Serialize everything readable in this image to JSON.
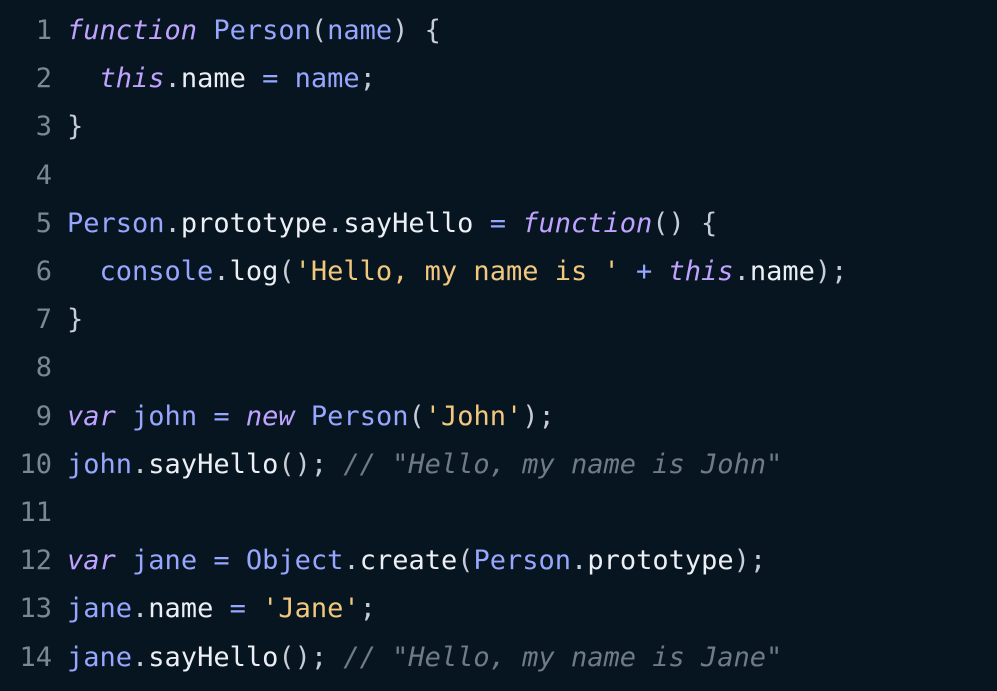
{
  "editor": {
    "background": "#071520",
    "colors": {
      "keyword": "#c0a3ff",
      "identifier": "#97a6ff",
      "property": "#eceff4",
      "string": "#f1c87e",
      "comment": "#6f7b88",
      "line_number": "#7a8794"
    },
    "lines": [
      {
        "number": "1",
        "tokens": [
          {
            "type": "kw",
            "text": "function"
          },
          {
            "type": "punc",
            "text": " "
          },
          {
            "type": "fn",
            "text": "Person"
          },
          {
            "type": "punc",
            "text": "("
          },
          {
            "type": "id",
            "text": "name"
          },
          {
            "type": "punc",
            "text": ") {"
          }
        ]
      },
      {
        "number": "2",
        "tokens": [
          {
            "type": "punc",
            "text": "  "
          },
          {
            "type": "kw",
            "text": "this"
          },
          {
            "type": "punc",
            "text": "."
          },
          {
            "type": "prop",
            "text": "name"
          },
          {
            "type": "punc",
            "text": " "
          },
          {
            "type": "op",
            "text": "="
          },
          {
            "type": "punc",
            "text": " "
          },
          {
            "type": "id",
            "text": "name"
          },
          {
            "type": "punc",
            "text": ";"
          }
        ]
      },
      {
        "number": "3",
        "tokens": [
          {
            "type": "punc",
            "text": "}"
          }
        ]
      },
      {
        "number": "4",
        "tokens": []
      },
      {
        "number": "5",
        "tokens": [
          {
            "type": "fn",
            "text": "Person"
          },
          {
            "type": "punc",
            "text": "."
          },
          {
            "type": "prop",
            "text": "prototype"
          },
          {
            "type": "punc",
            "text": "."
          },
          {
            "type": "prop",
            "text": "sayHello"
          },
          {
            "type": "punc",
            "text": " "
          },
          {
            "type": "op",
            "text": "="
          },
          {
            "type": "punc",
            "text": " "
          },
          {
            "type": "kw",
            "text": "function"
          },
          {
            "type": "punc",
            "text": "() {"
          }
        ]
      },
      {
        "number": "6",
        "tokens": [
          {
            "type": "punc",
            "text": "  "
          },
          {
            "type": "id",
            "text": "console"
          },
          {
            "type": "punc",
            "text": "."
          },
          {
            "type": "prop",
            "text": "log"
          },
          {
            "type": "punc",
            "text": "("
          },
          {
            "type": "str",
            "text": "'Hello, my name is '"
          },
          {
            "type": "punc",
            "text": " "
          },
          {
            "type": "op",
            "text": "+"
          },
          {
            "type": "punc",
            "text": " "
          },
          {
            "type": "kw",
            "text": "this"
          },
          {
            "type": "punc",
            "text": "."
          },
          {
            "type": "prop",
            "text": "name"
          },
          {
            "type": "punc",
            "text": ");"
          }
        ]
      },
      {
        "number": "7",
        "tokens": [
          {
            "type": "punc",
            "text": "}"
          }
        ]
      },
      {
        "number": "8",
        "tokens": []
      },
      {
        "number": "9",
        "tokens": [
          {
            "type": "kw",
            "text": "var"
          },
          {
            "type": "punc",
            "text": " "
          },
          {
            "type": "id",
            "text": "john"
          },
          {
            "type": "punc",
            "text": " "
          },
          {
            "type": "op",
            "text": "="
          },
          {
            "type": "punc",
            "text": " "
          },
          {
            "type": "kw",
            "text": "new"
          },
          {
            "type": "punc",
            "text": " "
          },
          {
            "type": "fn",
            "text": "Person"
          },
          {
            "type": "punc",
            "text": "("
          },
          {
            "type": "str",
            "text": "'John'"
          },
          {
            "type": "punc",
            "text": ");"
          }
        ]
      },
      {
        "number": "10",
        "tokens": [
          {
            "type": "id",
            "text": "john"
          },
          {
            "type": "punc",
            "text": "."
          },
          {
            "type": "prop",
            "text": "sayHello"
          },
          {
            "type": "punc",
            "text": "(); "
          },
          {
            "type": "cm",
            "text": "// \"Hello, my name is John\""
          }
        ]
      },
      {
        "number": "11",
        "tokens": []
      },
      {
        "number": "12",
        "tokens": [
          {
            "type": "kw",
            "text": "var"
          },
          {
            "type": "punc",
            "text": " "
          },
          {
            "type": "id",
            "text": "jane"
          },
          {
            "type": "punc",
            "text": " "
          },
          {
            "type": "op",
            "text": "="
          },
          {
            "type": "punc",
            "text": " "
          },
          {
            "type": "fn",
            "text": "Object"
          },
          {
            "type": "punc",
            "text": "."
          },
          {
            "type": "prop",
            "text": "create"
          },
          {
            "type": "punc",
            "text": "("
          },
          {
            "type": "fn",
            "text": "Person"
          },
          {
            "type": "punc",
            "text": "."
          },
          {
            "type": "prop",
            "text": "prototype"
          },
          {
            "type": "punc",
            "text": ");"
          }
        ]
      },
      {
        "number": "13",
        "tokens": [
          {
            "type": "id",
            "text": "jane"
          },
          {
            "type": "punc",
            "text": "."
          },
          {
            "type": "prop",
            "text": "name"
          },
          {
            "type": "punc",
            "text": " "
          },
          {
            "type": "op",
            "text": "="
          },
          {
            "type": "punc",
            "text": " "
          },
          {
            "type": "str",
            "text": "'Jane'"
          },
          {
            "type": "punc",
            "text": ";"
          }
        ]
      },
      {
        "number": "14",
        "tokens": [
          {
            "type": "id",
            "text": "jane"
          },
          {
            "type": "punc",
            "text": "."
          },
          {
            "type": "prop",
            "text": "sayHello"
          },
          {
            "type": "punc",
            "text": "(); "
          },
          {
            "type": "cm",
            "text": "// \"Hello, my name is Jane\""
          }
        ]
      }
    ]
  }
}
